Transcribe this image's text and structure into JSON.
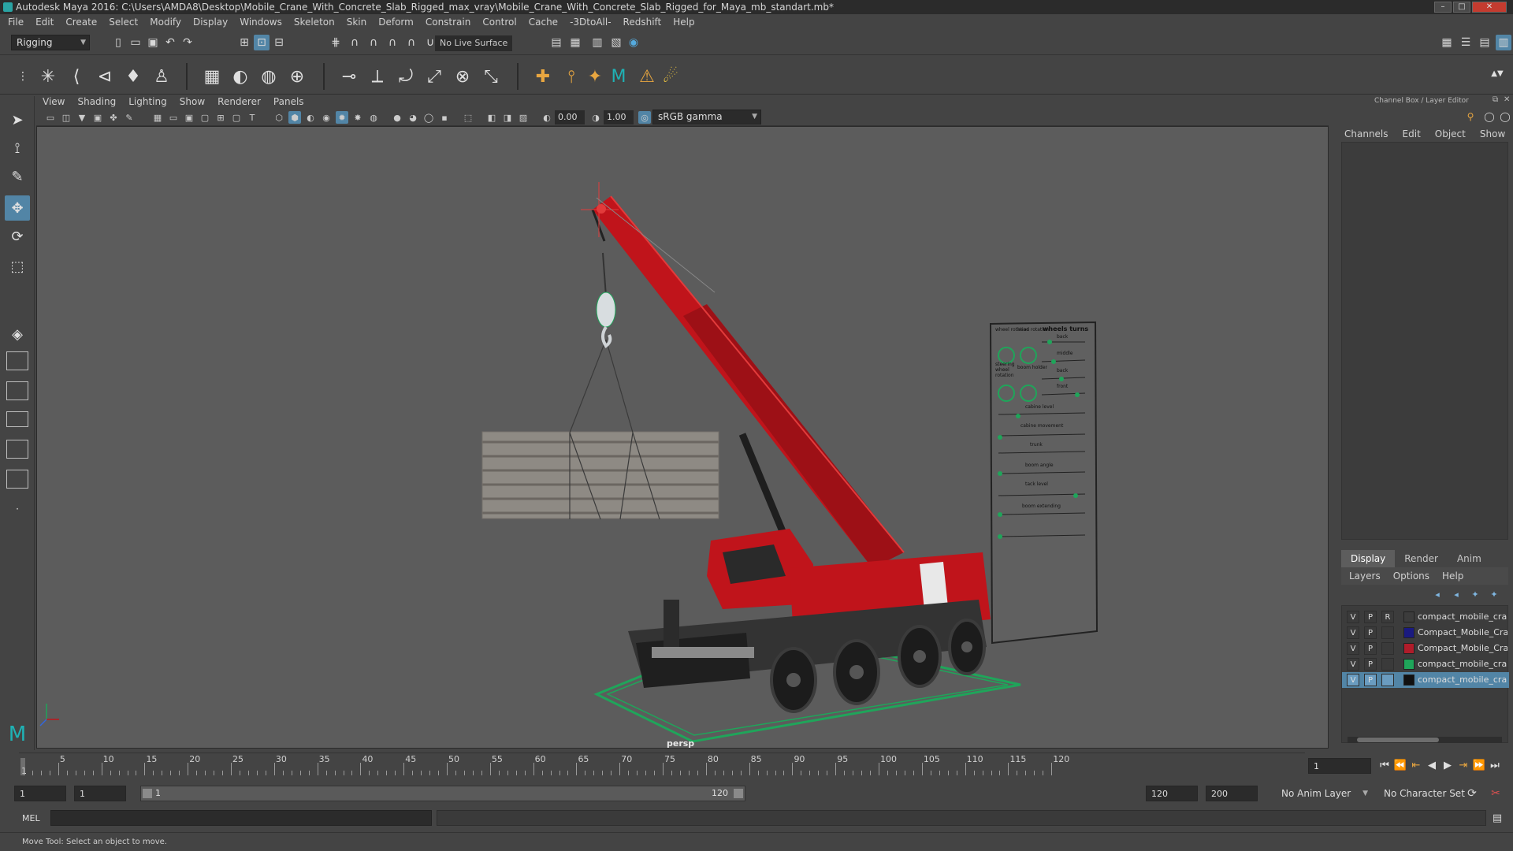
{
  "window": {
    "title": "Autodesk Maya 2016: C:\\Users\\AMDA8\\Desktop\\Mobile_Crane_With_Concrete_Slab_Rigged_max_vray\\Mobile_Crane_With_Concrete_Slab_Rigged_for_Maya_mb_standart.mb*"
  },
  "menubar": [
    "File",
    "Edit",
    "Create",
    "Select",
    "Modify",
    "Display",
    "Windows",
    "Skeleton",
    "Skin",
    "Deform",
    "Constrain",
    "Control",
    "Cache",
    "-3DtoAll-",
    "Redshift",
    "Help"
  ],
  "statusline": {
    "menuset": "Rigging",
    "live_surface": "No Live Surface"
  },
  "panel": {
    "menus": [
      "View",
      "Shading",
      "Lighting",
      "Show",
      "Renderer",
      "Panels"
    ],
    "exposure": "0.00",
    "gamma": "1.00",
    "color_space": "sRGB gamma",
    "camera_label": "persp"
  },
  "control_panel": {
    "labels": [
      "wheel rotation",
      "head rotation",
      "wheels turns",
      "back",
      "middle",
      "back",
      "front",
      "steering wheel rotation",
      "boom holder",
      "cabine level",
      "cabine movement",
      "trunk",
      "boom angle",
      "tack level",
      "boom extending"
    ]
  },
  "channel_box": {
    "title": "Channel Box / Layer Editor",
    "menus": [
      "Channels",
      "Edit",
      "Object",
      "Show"
    ],
    "layer_tabs": [
      "Display",
      "Render",
      "Anim"
    ],
    "layer_menus": [
      "Layers",
      "Options",
      "Help"
    ],
    "layers": [
      {
        "v": "V",
        "p": "P",
        "r": "R",
        "name": "compact_mobile_crane",
        "color": "#3c3c3c",
        "selected": false
      },
      {
        "v": "V",
        "p": "P",
        "r": "",
        "name": "Compact_Mobile_Crane",
        "color": "#1a1a80",
        "selected": false
      },
      {
        "v": "V",
        "p": "P",
        "r": "",
        "name": "Compact_Mobile_Crane",
        "color": "#b01c2a",
        "selected": false
      },
      {
        "v": "V",
        "p": "P",
        "r": "",
        "name": "compact_mobile_crane",
        "color": "#1fa55a",
        "selected": false
      },
      {
        "v": "V",
        "p": "P",
        "r": "",
        "name": "compact_mobile_crane",
        "color": "#111111",
        "selected": true
      }
    ]
  },
  "timeline": {
    "ticks": [
      "5",
      "10",
      "15",
      "20",
      "25",
      "30",
      "35",
      "40",
      "45",
      "50",
      "55",
      "60",
      "65",
      "70",
      "75",
      "80",
      "85",
      "90",
      "95",
      "100",
      "105",
      "110",
      "115",
      "120"
    ],
    "start_marker": "1",
    "current_frame": "1"
  },
  "range": {
    "start": "1",
    "playback_start": "1",
    "slider_start": "1",
    "slider_end": "120",
    "playback_end": "120",
    "end": "200",
    "anim_layer": "No Anim Layer",
    "character_set": "No Character Set"
  },
  "command": {
    "language": "MEL"
  },
  "helpline": {
    "text": "Move Tool: Select an object to move."
  },
  "colors": {
    "accent": "#5285a6",
    "crane_red": "#c0141b",
    "rig_green": "#1fa55a"
  }
}
